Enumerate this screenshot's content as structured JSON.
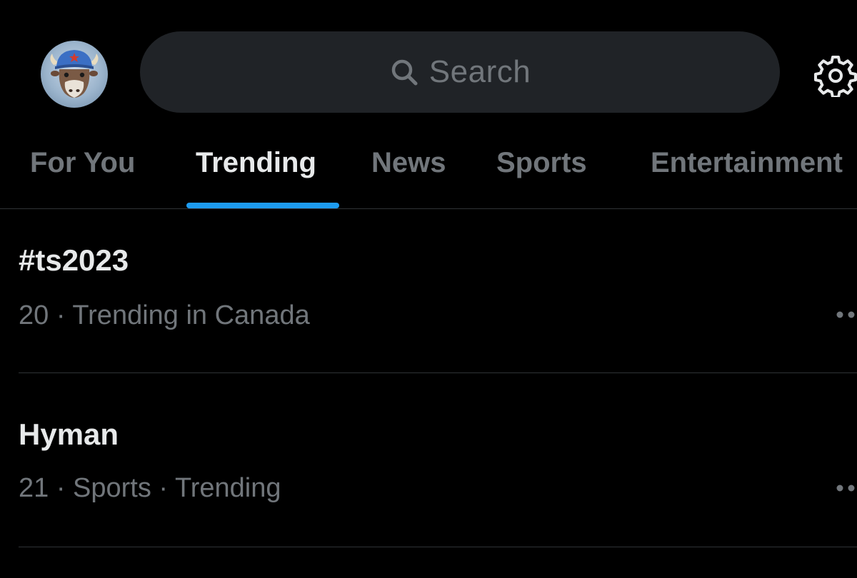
{
  "header": {
    "avatar_icon": "profile-avatar-bison",
    "search_placeholder": "Search",
    "search_icon": "search-icon",
    "settings_icon": "gear-icon"
  },
  "tabs": [
    {
      "label": "For You",
      "active": false
    },
    {
      "label": "Trending",
      "active": true
    },
    {
      "label": "News",
      "active": false
    },
    {
      "label": "Sports",
      "active": false
    },
    {
      "label": "Entertainment",
      "active": false
    }
  ],
  "trends": [
    {
      "title": "#ts2023",
      "meta": "20 · Trending in Canada"
    },
    {
      "title": "Hyman",
      "meta": "21 · Sports · Trending"
    }
  ],
  "colors": {
    "background": "#000000",
    "accent": "#1d9bf0",
    "text_primary": "#e7e9ea",
    "text_secondary": "#71767b",
    "search_bg": "#202327"
  }
}
